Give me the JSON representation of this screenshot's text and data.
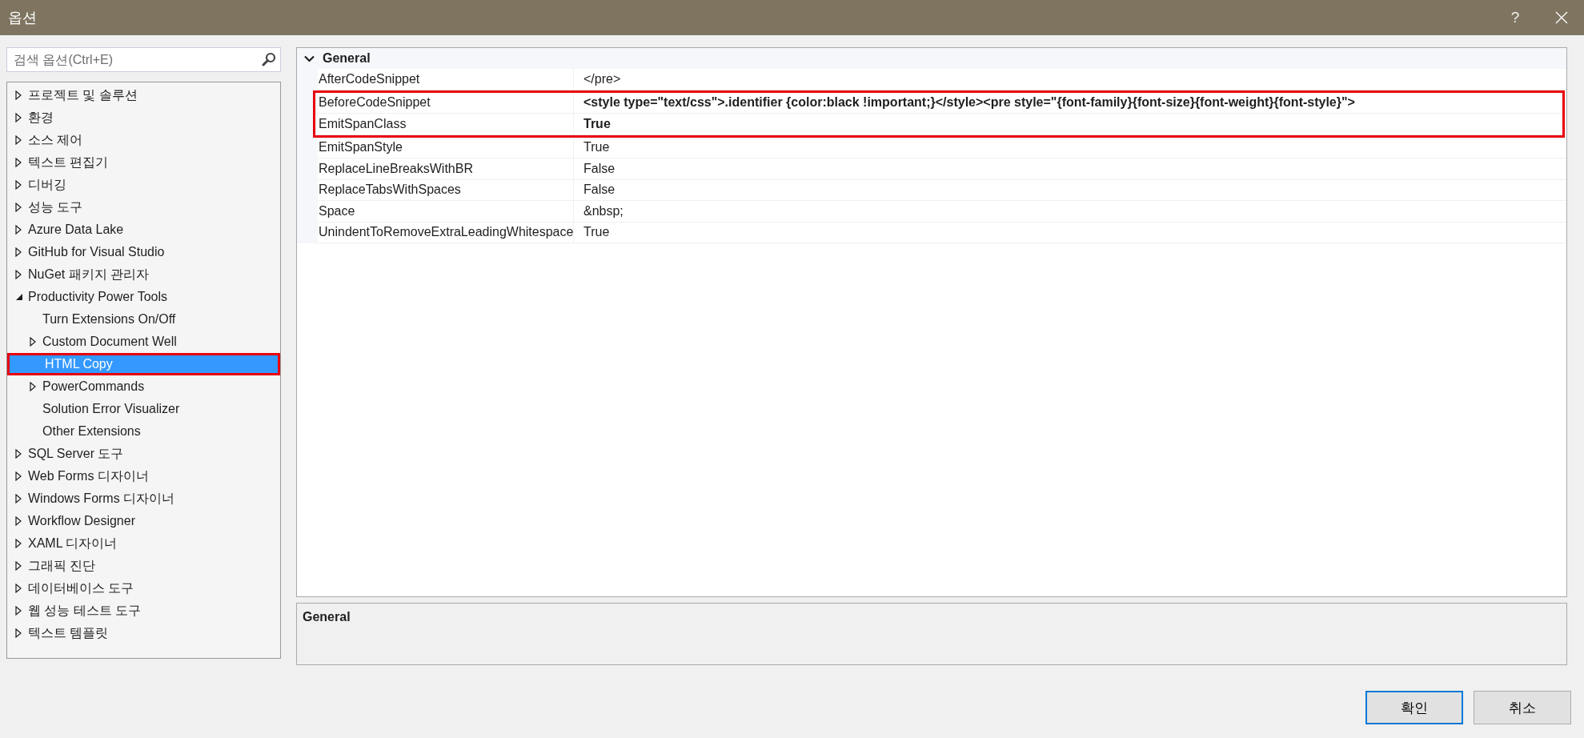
{
  "window": {
    "title": "옵션",
    "help": "?"
  },
  "search": {
    "placeholder": "검색 옵션(Ctrl+E)"
  },
  "tree": {
    "items": [
      {
        "label": "프로젝트 및 솔루션",
        "expanded": false,
        "selected": false,
        "highlighted": false
      },
      {
        "label": "환경",
        "expanded": false,
        "selected": false,
        "highlighted": false
      },
      {
        "label": "소스 제어",
        "expanded": false,
        "selected": false,
        "highlighted": false
      },
      {
        "label": "텍스트 편집기",
        "expanded": false,
        "selected": false,
        "highlighted": false
      },
      {
        "label": "디버깅",
        "expanded": false,
        "selected": false,
        "highlighted": false
      },
      {
        "label": "성능 도구",
        "expanded": false,
        "selected": false,
        "highlighted": false
      },
      {
        "label": "Azure Data Lake",
        "expanded": false,
        "selected": false,
        "highlighted": false
      },
      {
        "label": "GitHub for Visual Studio",
        "expanded": false,
        "selected": false,
        "highlighted": false
      },
      {
        "label": "NuGet 패키지 관리자",
        "expanded": false,
        "selected": false,
        "highlighted": false
      },
      {
        "label": "Productivity Power Tools",
        "expanded": true,
        "selected": false,
        "highlighted": false,
        "children": [
          {
            "label": "Turn Extensions On/Off",
            "selected": false,
            "highlighted": false
          },
          {
            "label": "Custom Document Well",
            "expanded": false,
            "selected": false,
            "highlighted": false
          },
          {
            "label": "HTML Copy",
            "selected": true,
            "highlighted": true
          },
          {
            "label": "PowerCommands",
            "expanded": false,
            "selected": false,
            "highlighted": false
          },
          {
            "label": "Solution Error Visualizer",
            "selected": false,
            "highlighted": false
          },
          {
            "label": "Other Extensions",
            "selected": false,
            "highlighted": false
          }
        ]
      },
      {
        "label": "SQL Server 도구",
        "expanded": false,
        "selected": false,
        "highlighted": false
      },
      {
        "label": "Web Forms 디자이너",
        "expanded": false,
        "selected": false,
        "highlighted": false
      },
      {
        "label": "Windows Forms 디자이너",
        "expanded": false,
        "selected": false,
        "highlighted": false
      },
      {
        "label": "Workflow Designer",
        "expanded": false,
        "selected": false,
        "highlighted": false
      },
      {
        "label": "XAML 디자이너",
        "expanded": false,
        "selected": false,
        "highlighted": false
      },
      {
        "label": "그래픽 진단",
        "expanded": false,
        "selected": false,
        "highlighted": false
      },
      {
        "label": "데이터베이스 도구",
        "expanded": false,
        "selected": false,
        "highlighted": false
      },
      {
        "label": "웹 성능 테스트 도구",
        "expanded": false,
        "selected": false,
        "highlighted": false
      },
      {
        "label": "텍스트 템플릿",
        "expanded": false,
        "selected": false,
        "highlighted": false
      }
    ]
  },
  "property_grid": {
    "category": {
      "label": "General",
      "expanded": true
    },
    "rows": [
      {
        "name": "AfterCodeSnippet",
        "value": "</pre>",
        "modified": false,
        "highlighted": false
      },
      {
        "name": "BeforeCodeSnippet",
        "value": "<style type=\"text/css\">.identifier {color:black !important;}</style><pre style=\"{font-family}{font-size}{font-weight}{font-style}\">",
        "modified": true,
        "highlighted": true
      },
      {
        "name": "EmitSpanClass",
        "value": "True",
        "modified": true,
        "highlighted": true
      },
      {
        "name": "EmitSpanStyle",
        "value": "True",
        "modified": false,
        "highlighted": false
      },
      {
        "name": "ReplaceLineBreaksWithBR",
        "value": "False",
        "modified": false,
        "highlighted": false
      },
      {
        "name": "ReplaceTabsWithSpaces",
        "value": "False",
        "modified": false,
        "highlighted": false
      },
      {
        "name": "Space",
        "value": "&nbsp;",
        "modified": false,
        "highlighted": false
      },
      {
        "name": "UnindentToRemoveExtraLeadingWhitespace",
        "value": "True",
        "modified": false,
        "highlighted": false
      }
    ]
  },
  "description": {
    "title": "General"
  },
  "buttons": [
    {
      "label": "확인",
      "default": true
    },
    {
      "label": "취소",
      "default": false
    }
  ]
}
